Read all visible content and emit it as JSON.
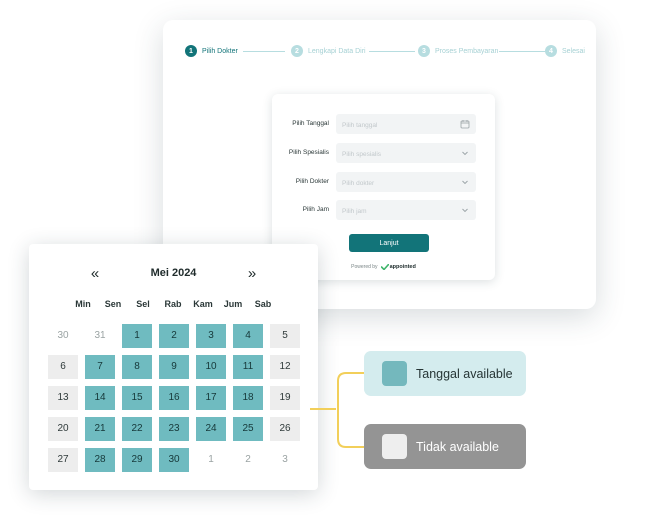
{
  "booking": {
    "steps": [
      {
        "number": "1",
        "label": "Pilih Dokter",
        "state": "active"
      },
      {
        "number": "2",
        "label": "Lengkapi Data Diri",
        "state": "inactive"
      },
      {
        "number": "3",
        "label": "Proses Pembayaran",
        "state": "inactive"
      },
      {
        "number": "4",
        "label": "Selesai",
        "state": "inactive"
      }
    ],
    "form": {
      "date": {
        "label": "Pilih Tanggal",
        "placeholder": "Pilih tanggal",
        "icon": "calendar-icon"
      },
      "specialist": {
        "label": "Pilih Spesialis",
        "placeholder": "Pilih spesialis",
        "icon": "chevron-down-icon"
      },
      "doctor": {
        "label": "Pilih Dokter",
        "placeholder": "Pilih dokter",
        "icon": "chevron-down-icon"
      },
      "time": {
        "label": "Pilih Jam",
        "placeholder": "Pilih jam",
        "icon": "chevron-down-icon"
      },
      "submit_label": "Lanjut",
      "powered_by": "Powered by",
      "brand_name": "appointed"
    }
  },
  "calendar": {
    "prev_label": "«",
    "next_label": "»",
    "month_title": "Mei 2024",
    "weekdays": [
      "Min",
      "Sen",
      "Sel",
      "Rab",
      "Kam",
      "Jum",
      "Sab"
    ],
    "weeks": [
      [
        {
          "d": "30",
          "s": "outside"
        },
        {
          "d": "31",
          "s": "outside"
        },
        {
          "d": "1",
          "s": "available"
        },
        {
          "d": "2",
          "s": "available"
        },
        {
          "d": "3",
          "s": "available"
        },
        {
          "d": "4",
          "s": "available"
        },
        {
          "d": "5",
          "s": "unavailable"
        }
      ],
      [
        {
          "d": "6",
          "s": "unavailable"
        },
        {
          "d": "7",
          "s": "available"
        },
        {
          "d": "8",
          "s": "available"
        },
        {
          "d": "9",
          "s": "available"
        },
        {
          "d": "10",
          "s": "available"
        },
        {
          "d": "11",
          "s": "available"
        },
        {
          "d": "12",
          "s": "unavailable"
        }
      ],
      [
        {
          "d": "13",
          "s": "unavailable"
        },
        {
          "d": "14",
          "s": "available"
        },
        {
          "d": "15",
          "s": "available"
        },
        {
          "d": "16",
          "s": "available"
        },
        {
          "d": "17",
          "s": "available"
        },
        {
          "d": "18",
          "s": "available"
        },
        {
          "d": "19",
          "s": "unavailable"
        }
      ],
      [
        {
          "d": "20",
          "s": "unavailable"
        },
        {
          "d": "21",
          "s": "available"
        },
        {
          "d": "22",
          "s": "available"
        },
        {
          "d": "23",
          "s": "available"
        },
        {
          "d": "24",
          "s": "available"
        },
        {
          "d": "25",
          "s": "available"
        },
        {
          "d": "26",
          "s": "unavailable"
        }
      ],
      [
        {
          "d": "27",
          "s": "unavailable"
        },
        {
          "d": "28",
          "s": "available"
        },
        {
          "d": "29",
          "s": "available"
        },
        {
          "d": "30",
          "s": "available"
        },
        {
          "d": "1",
          "s": "outside"
        },
        {
          "d": "2",
          "s": "outside"
        },
        {
          "d": "3",
          "s": "outside"
        }
      ]
    ]
  },
  "legend": {
    "available_label": "Tanggal available",
    "unavailable_label": "Tidak available"
  },
  "colors": {
    "primary": "#127479",
    "available": "#6fbbc0",
    "unavailable": "#ededed",
    "legend_available_bg": "#d4ecee",
    "legend_unavailable_bg": "#949494",
    "connector": "#f2cf5a"
  }
}
